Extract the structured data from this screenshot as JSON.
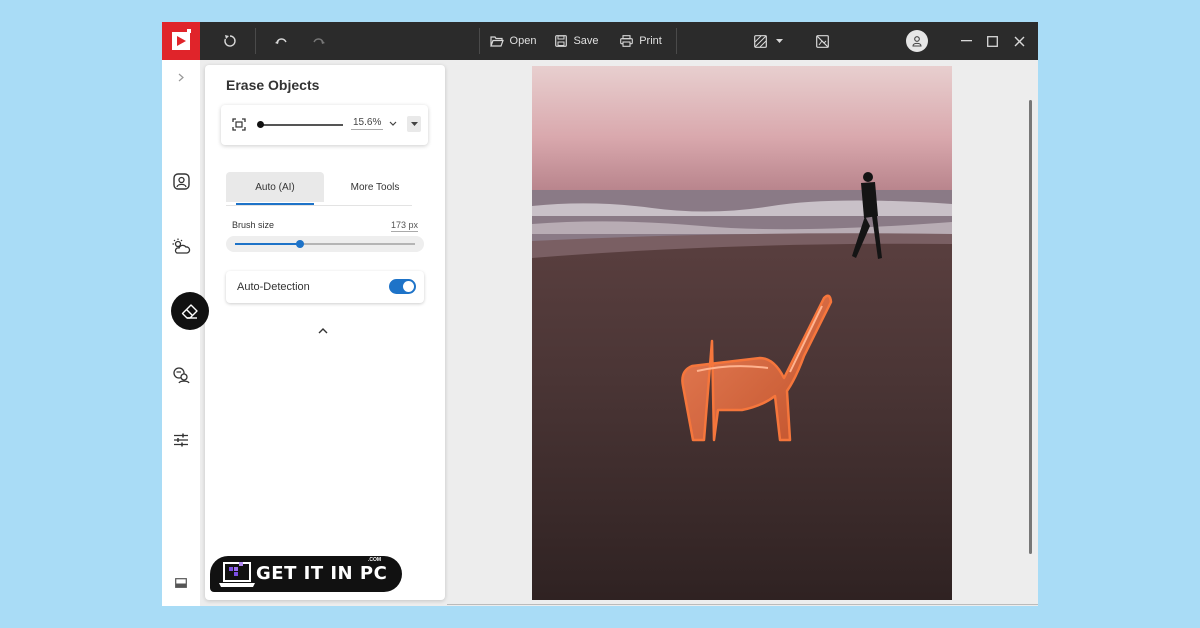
{
  "toolbar": {
    "open_label": "Open",
    "save_label": "Save",
    "print_label": "Print"
  },
  "panel": {
    "title": "Erase Objects",
    "zoom_value": "15.6%",
    "zoom_level": 0.156,
    "tabs": [
      {
        "label": "Auto (AI)",
        "active": true
      },
      {
        "label": "More Tools",
        "active": false
      }
    ],
    "brush_size_label": "Brush size",
    "brush_size_value": "173 px",
    "brush_size_fraction": 0.36,
    "auto_detection_label": "Auto-Detection",
    "auto_detection_on": true
  },
  "watermark": {
    "text": "GET IT IN PC",
    "com": ".COM"
  },
  "colors": {
    "brand": "#e0242a",
    "accent": "#1e73c8",
    "titlebar": "#2b2b2b",
    "selection": "#e8642a"
  },
  "icons": {
    "rail": [
      "chevron-right-icon",
      "portrait-icon",
      "sky-weather-icon",
      "eraser-icon",
      "face-swap-icon",
      "adjust-sliders-icon",
      "panel-toggle-icon"
    ]
  }
}
